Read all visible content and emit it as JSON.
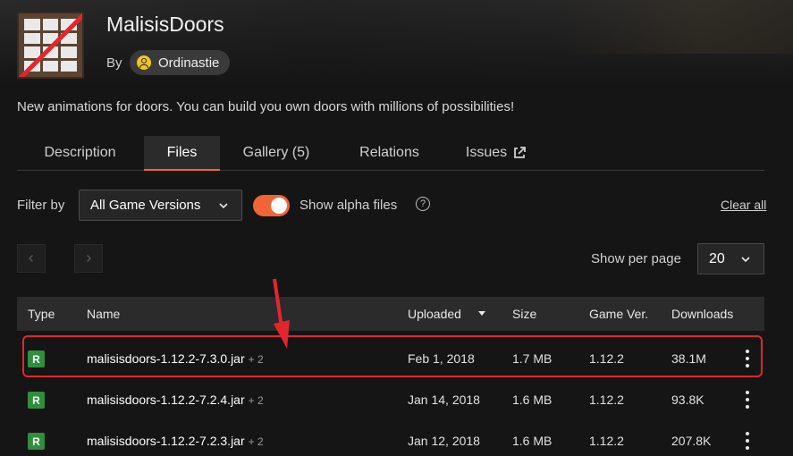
{
  "project": {
    "title": "MalisisDoors",
    "by_label": "By",
    "author": "Ordinastie",
    "description": "New animations for doors. You can build you own doors with millions of possibilities!"
  },
  "tabs": [
    {
      "label": "Description"
    },
    {
      "label": "Files"
    },
    {
      "label": "Gallery (5)"
    },
    {
      "label": "Relations"
    },
    {
      "label": "Issues"
    }
  ],
  "filters": {
    "filter_by_label": "Filter by",
    "game_version_selected": "All Game Versions",
    "show_alpha_label": "Show alpha files",
    "show_alpha_enabled": true,
    "help_glyph": "?",
    "clear_all_label": "Clear all"
  },
  "pagination": {
    "prev_glyph": "‹",
    "next_glyph": "›",
    "per_page_label": "Show per page",
    "per_page_value": "20"
  },
  "table": {
    "headers": {
      "type": "Type",
      "name": "Name",
      "uploaded": "Uploaded",
      "size": "Size",
      "game_ver": "Game Ver.",
      "downloads": "Downloads"
    },
    "rows": [
      {
        "type": "R",
        "name": "malisisdoors-1.12.2-7.3.0.jar",
        "extra": "+ 2",
        "uploaded": "Feb 1, 2018",
        "size": "1.7 MB",
        "game_ver": "1.12.2",
        "downloads": "38.1M"
      },
      {
        "type": "R",
        "name": "malisisdoors-1.12.2-7.2.4.jar",
        "extra": "+ 2",
        "uploaded": "Jan 14, 2018",
        "size": "1.6 MB",
        "game_ver": "1.12.2",
        "downloads": "93.8K"
      },
      {
        "type": "R",
        "name": "malisisdoors-1.12.2-7.2.3.jar",
        "extra": "+ 2",
        "uploaded": "Jan 12, 2018",
        "size": "1.6 MB",
        "game_ver": "1.12.2",
        "downloads": "207.8K"
      }
    ]
  },
  "colors": {
    "accent": "#f16436",
    "release_badge": "#2e8f3d",
    "highlight": "#e2262f"
  }
}
